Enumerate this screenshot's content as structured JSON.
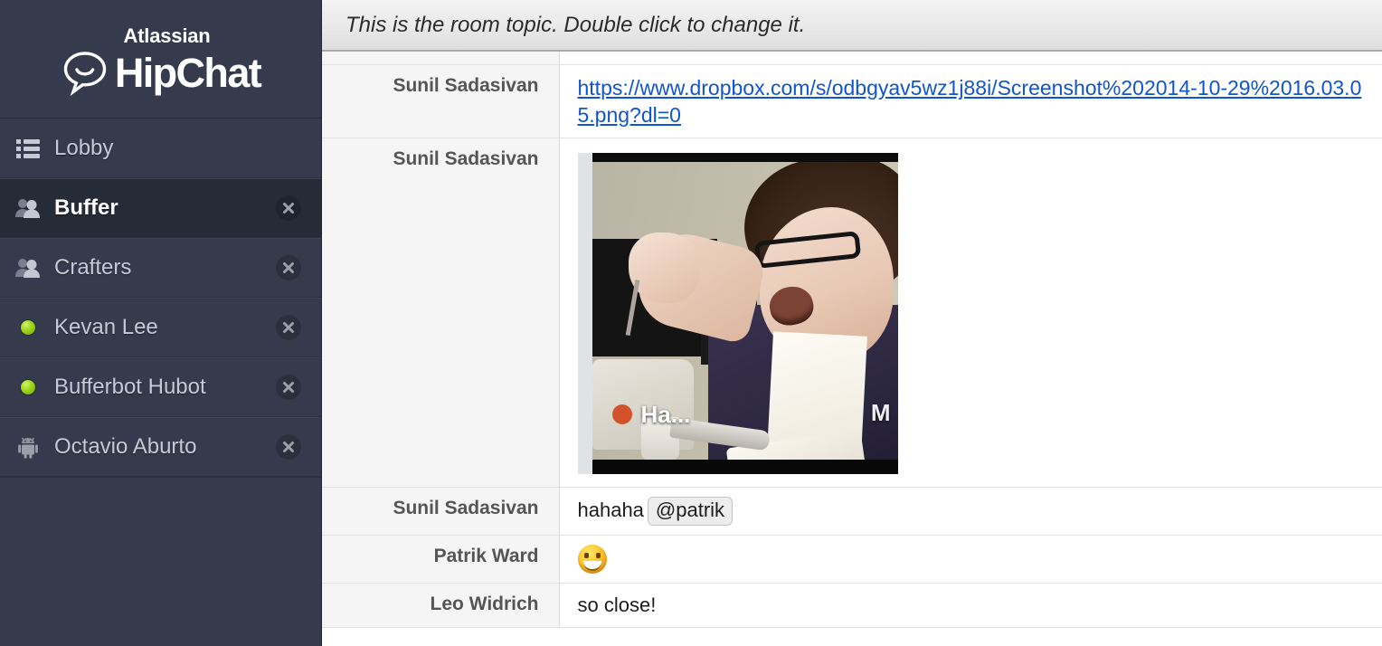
{
  "sidebar": {
    "brand": {
      "company": "Atlassian",
      "product": "HipChat",
      "logo_icon": "speech-bubble-icon"
    },
    "items": [
      {
        "label": "Lobby",
        "icon": "list-icon",
        "selected": false,
        "closable": false,
        "presence": "none"
      },
      {
        "label": "Buffer",
        "icon": "group-icon",
        "selected": true,
        "closable": true,
        "presence": "none"
      },
      {
        "label": "Crafters",
        "icon": "group-icon",
        "selected": false,
        "closable": true,
        "presence": "none"
      },
      {
        "label": "Kevan Lee",
        "icon": "presence-dot",
        "selected": false,
        "closable": true,
        "presence": "available"
      },
      {
        "label": "Bufferbot Hubot",
        "icon": "presence-dot",
        "selected": false,
        "closable": true,
        "presence": "available"
      },
      {
        "label": "Octavio Aburto",
        "icon": "android-icon",
        "selected": false,
        "closable": true,
        "presence": "mobile"
      }
    ],
    "close_label": "×"
  },
  "topic": {
    "text": "This is the room topic. Double click to change it."
  },
  "chat": {
    "messages": [
      {
        "author": "",
        "type": "clipped",
        "text": ""
      },
      {
        "author": "Sunil Sadasivan",
        "type": "link",
        "text": "https://www.dropbox.com/s/odbgyav5wz1j88i/Screenshot%202014-10-29%2016.03.05.png?dl=0"
      },
      {
        "author": "Sunil Sadasivan",
        "type": "image",
        "text": "",
        "image_overlay_text": "Ha...",
        "image_corner_text": "M"
      },
      {
        "author": "Sunil Sadasivan",
        "type": "mention",
        "text": "hahaha",
        "mention": "@patrik"
      },
      {
        "author": "Patrik Ward",
        "type": "emoji",
        "text": "",
        "emoji_name": "grinning-face"
      },
      {
        "author": "Leo Widrich",
        "type": "text",
        "text": "so close!"
      }
    ]
  },
  "colors": {
    "sidebar_bg": "#353b4d",
    "sidebar_selected_bg": "#262b38",
    "link": "#1155cc",
    "presence_online": "#9ed417",
    "name_column_bg": "#f5f5f5",
    "topic_bar_bg": "#e8e8e8"
  }
}
